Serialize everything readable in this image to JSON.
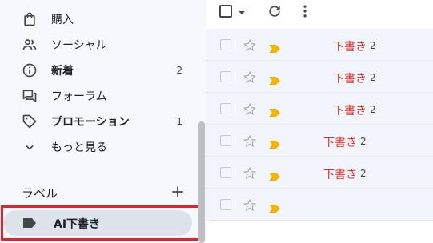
{
  "sidebar": {
    "items": [
      {
        "label": "購入",
        "icon": "shopping-bag-icon",
        "bold": false,
        "count": ""
      },
      {
        "label": "ソーシャル",
        "icon": "people-icon",
        "bold": false,
        "count": ""
      },
      {
        "label": "新着",
        "icon": "info-icon",
        "bold": true,
        "count": "2"
      },
      {
        "label": "フォーラム",
        "icon": "forum-icon",
        "bold": false,
        "count": ""
      },
      {
        "label": "プロモーション",
        "icon": "tag-icon",
        "bold": true,
        "count": "1"
      },
      {
        "label": "もっと見る",
        "icon": "chevron-down-icon",
        "bold": false,
        "count": ""
      }
    ],
    "labels_title": "ラベル",
    "label_item": {
      "name": "AI下書き",
      "icon": "label-icon"
    }
  },
  "toolbar": {
    "select_all": "checkbox-icon",
    "select_menu": "caret-down-icon",
    "refresh": "refresh-icon",
    "more": "more-vert-icon"
  },
  "rows": [
    {
      "draft": "下書き",
      "count": "2"
    },
    {
      "draft": "下書き",
      "count": "2"
    },
    {
      "draft": "下書き",
      "count": "2"
    },
    {
      "draft": "下書き",
      "count": "2"
    },
    {
      "draft": "下書き",
      "count": "2"
    },
    {
      "draft": "",
      "count": ""
    }
  ],
  "colors": {
    "highlight": "#e8202a",
    "draft_text": "#d93025",
    "important_marker": "#f4b400",
    "selected_label_bg": "#dde3ea"
  }
}
